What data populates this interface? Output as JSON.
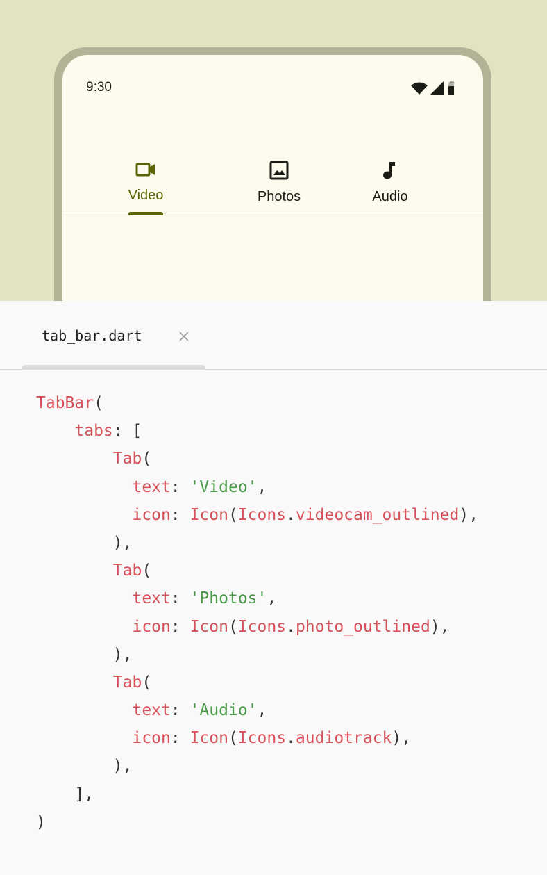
{
  "preview": {
    "status_time": "9:30",
    "tabs": [
      {
        "label": "Video",
        "icon": "videocam-outlined-icon",
        "active": true
      },
      {
        "label": "Photos",
        "icon": "photo-outlined-icon",
        "active": false
      },
      {
        "label": "Audio",
        "icon": "audiotrack-icon",
        "active": false
      }
    ],
    "colors": {
      "accent": "#5b6300",
      "background": "#e2e3c1",
      "screen": "#fdfbee"
    }
  },
  "editor": {
    "file_name": "tab_bar.dart",
    "close_glyph": "×",
    "code_lines": [
      [
        {
          "t": "k",
          "v": "TabBar"
        },
        {
          "t": "p",
          "v": "("
        }
      ],
      [
        {
          "t": "p",
          "v": "    "
        },
        {
          "t": "k",
          "v": "tabs"
        },
        {
          "t": "p",
          "v": ": ["
        }
      ],
      [
        {
          "t": "p",
          "v": "        "
        },
        {
          "t": "k",
          "v": "Tab"
        },
        {
          "t": "p",
          "v": "("
        }
      ],
      [
        {
          "t": "p",
          "v": "          "
        },
        {
          "t": "k",
          "v": "text"
        },
        {
          "t": "p",
          "v": ": "
        },
        {
          "t": "s",
          "v": "'Video'"
        },
        {
          "t": "p",
          "v": ","
        }
      ],
      [
        {
          "t": "p",
          "v": "          "
        },
        {
          "t": "k",
          "v": "icon"
        },
        {
          "t": "p",
          "v": ": "
        },
        {
          "t": "k",
          "v": "Icon"
        },
        {
          "t": "p",
          "v": "("
        },
        {
          "t": "k",
          "v": "Icons"
        },
        {
          "t": "p",
          "v": "."
        },
        {
          "t": "k",
          "v": "videocam_outlined"
        },
        {
          "t": "p",
          "v": "),"
        }
      ],
      [
        {
          "t": "p",
          "v": "        ),"
        }
      ],
      [
        {
          "t": "p",
          "v": "        "
        },
        {
          "t": "k",
          "v": "Tab"
        },
        {
          "t": "p",
          "v": "("
        }
      ],
      [
        {
          "t": "p",
          "v": "          "
        },
        {
          "t": "k",
          "v": "text"
        },
        {
          "t": "p",
          "v": ": "
        },
        {
          "t": "s",
          "v": "'Photos'"
        },
        {
          "t": "p",
          "v": ","
        }
      ],
      [
        {
          "t": "p",
          "v": "          "
        },
        {
          "t": "k",
          "v": "icon"
        },
        {
          "t": "p",
          "v": ": "
        },
        {
          "t": "k",
          "v": "Icon"
        },
        {
          "t": "p",
          "v": "("
        },
        {
          "t": "k",
          "v": "Icons"
        },
        {
          "t": "p",
          "v": "."
        },
        {
          "t": "k",
          "v": "photo_outlined"
        },
        {
          "t": "p",
          "v": "),"
        }
      ],
      [
        {
          "t": "p",
          "v": "        ),"
        }
      ],
      [
        {
          "t": "p",
          "v": "        "
        },
        {
          "t": "k",
          "v": "Tab"
        },
        {
          "t": "p",
          "v": "("
        }
      ],
      [
        {
          "t": "p",
          "v": "          "
        },
        {
          "t": "k",
          "v": "text"
        },
        {
          "t": "p",
          "v": ": "
        },
        {
          "t": "s",
          "v": "'Audio'"
        },
        {
          "t": "p",
          "v": ","
        }
      ],
      [
        {
          "t": "p",
          "v": "          "
        },
        {
          "t": "k",
          "v": "icon"
        },
        {
          "t": "p",
          "v": ": "
        },
        {
          "t": "k",
          "v": "Icon"
        },
        {
          "t": "p",
          "v": "("
        },
        {
          "t": "k",
          "v": "Icons"
        },
        {
          "t": "p",
          "v": "."
        },
        {
          "t": "k",
          "v": "audiotrack"
        },
        {
          "t": "p",
          "v": "),"
        }
      ],
      [
        {
          "t": "p",
          "v": "        ),"
        }
      ],
      [
        {
          "t": "p",
          "v": "    ],"
        }
      ],
      [
        {
          "t": "p",
          "v": ")"
        }
      ]
    ]
  }
}
